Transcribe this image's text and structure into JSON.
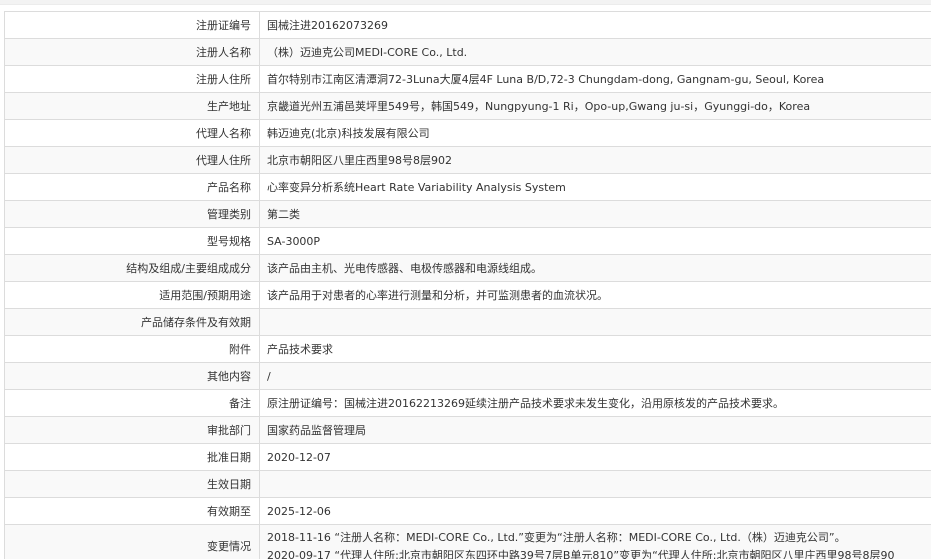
{
  "rows": [
    {
      "label": "注册证编号",
      "value": "国械注进20162073269"
    },
    {
      "label": "注册人名称",
      "value": "（株）迈迪克公司MEDI-CORE Co., Ltd."
    },
    {
      "label": "注册人住所",
      "value": "首尔特别市江南区清潭洞72-3Luna大厦4层4F Luna B/D,72-3 Chungdam-dong, Gangnam-gu, Seoul, Korea"
    },
    {
      "label": "生产地址",
      "value": "京畿道光州五浦邑荚坪里549号，韩国549，Nungpyung-1 Ri，Opo-up,Gwang ju-si，Gyunggi-do，Korea"
    },
    {
      "label": "代理人名称",
      "value": "韩迈迪克(北京)科技发展有限公司"
    },
    {
      "label": "代理人住所",
      "value": "北京市朝阳区八里庄西里98号8层902"
    },
    {
      "label": "产品名称",
      "value": "心率变异分析系统Heart Rate Variability Analysis System"
    },
    {
      "label": "管理类别",
      "value": "第二类"
    },
    {
      "label": "型号规格",
      "value": "SA-3000P"
    },
    {
      "label": "结构及组成/主要组成成分",
      "value": "该产品由主机、光电传感器、电极传感器和电源线组成。"
    },
    {
      "label": "适用范围/预期用途",
      "value": "该产品用于对患者的心率进行测量和分析，并可监测患者的血流状况。"
    },
    {
      "label": "产品储存条件及有效期",
      "value": ""
    },
    {
      "label": "附件",
      "value": "产品技术要求"
    },
    {
      "label": "其他内容",
      "value": "/"
    },
    {
      "label": "备注",
      "value": "原注册证编号：国械注进20162213269延续注册产品技术要求未发生变化，沿用原核发的产品技术要求。"
    },
    {
      "label": "审批部门",
      "value": "国家药品监督管理局"
    },
    {
      "label": "批准日期",
      "value": "2020-12-07"
    },
    {
      "label": "生效日期",
      "value": ""
    },
    {
      "label": "有效期至",
      "value": "2025-12-06"
    }
  ],
  "changes": {
    "label": "变更情况",
    "lines": [
      "2018-11-16 “注册人名称：MEDI-CORE Co., Ltd.”变更为“注册人名称：MEDI-CORE Co., Ltd.（株）迈迪克公司”。",
      "2020-09-17 “代理人住所:北京市朝阳区东四环中路39号7层B单元810”变更为“代理人住所:北京市朝阳区八里庄西里98号8层90"
    ]
  }
}
